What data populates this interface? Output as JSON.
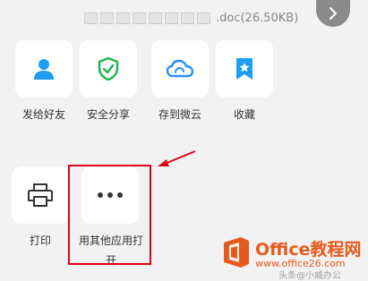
{
  "file": {
    "name_suffix": ".doc(26.50KB)"
  },
  "actions_row1": [
    {
      "label": "发给好友",
      "icon": "person-icon",
      "color": "#1e9df2"
    },
    {
      "label": "安全分享",
      "icon": "shield-check-icon",
      "color": "#22b14c"
    },
    {
      "label": "存到微云",
      "icon": "cloud-icon",
      "color": "#2a8ff7"
    },
    {
      "label": "收藏",
      "icon": "bookmark-star-icon",
      "color": "#1e9df2"
    }
  ],
  "actions_row2": [
    {
      "label": "打印",
      "icon": "printer-icon"
    },
    {
      "label": "用其他应用打开",
      "icon": "more-dots-icon"
    }
  ],
  "annotation": {
    "color": "#e0001b"
  },
  "watermark": {
    "title": "Office教程网",
    "site": "www.office26.com",
    "sub": "头条@小威办公"
  }
}
